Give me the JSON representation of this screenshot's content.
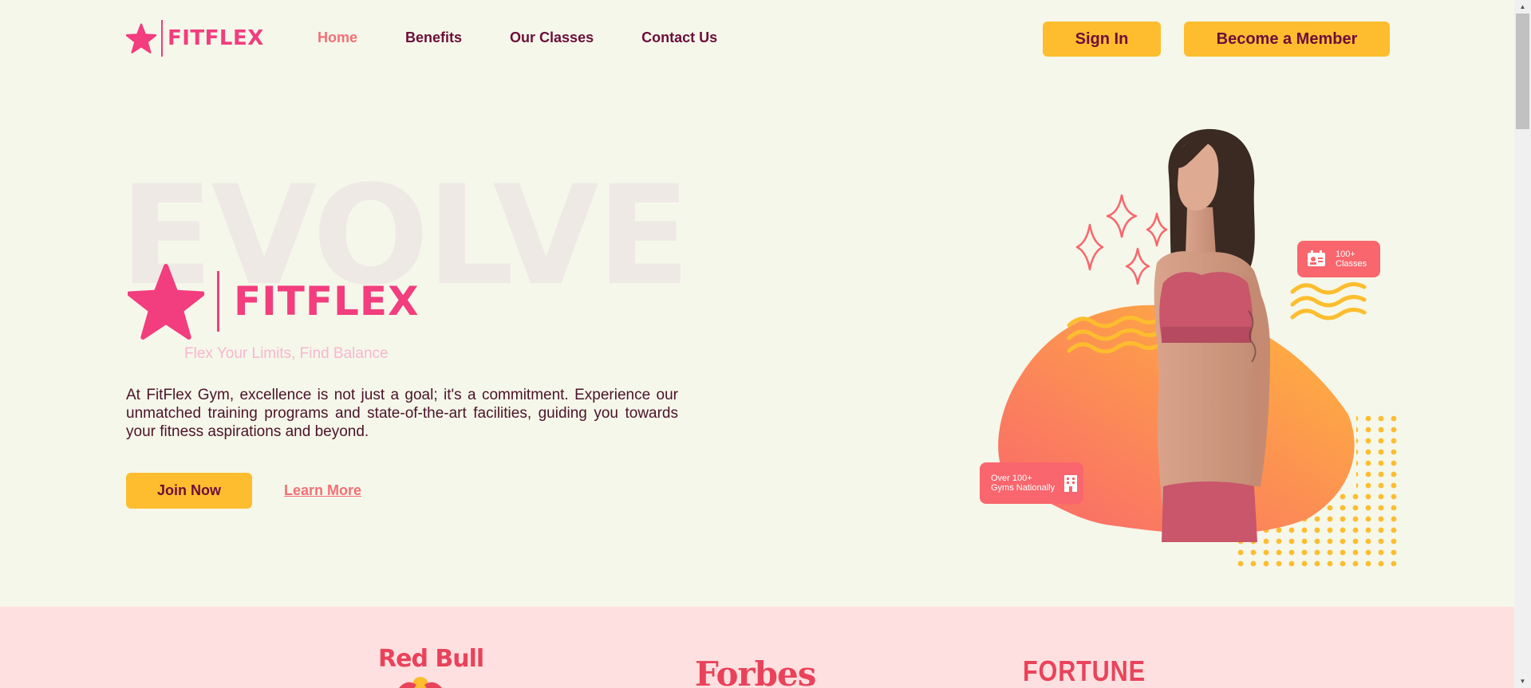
{
  "header": {
    "logo_text": "FITFLEX",
    "nav": [
      {
        "label": "Home",
        "active": true
      },
      {
        "label": "Benefits",
        "active": false
      },
      {
        "label": "Our Classes",
        "active": false
      },
      {
        "label": "Contact Us",
        "active": false
      }
    ],
    "sign_in_label": "Sign In",
    "member_label": "Become a Member"
  },
  "hero": {
    "bg_word": "EVOLVE",
    "logo_text": "FITFLEX",
    "tagline": "Flex Your Limits, Find Balance",
    "description": "At FitFlex Gym, excellence is not just a goal; it's a commitment. Experience our unmatched training programs and state-of-the-art facilities, guiding you towards your fitness aspirations and beyond.",
    "join_label": "Join Now",
    "learn_label": "Learn More",
    "card_classes": {
      "line1": "100+",
      "line2": "Classes"
    },
    "card_gyms": {
      "line1": "Over 100+",
      "line2": "Gyms Nationally"
    }
  },
  "partners": {
    "redbull": "Red Bull",
    "forbes": "Forbes",
    "fortune": "FORTUNE"
  },
  "colors": {
    "background": "#f5f7ea",
    "brand_pink": "#f23d7e",
    "accent_yellow": "#fdbd2e",
    "text_maroon": "#6b0f3a",
    "coral": "#f27076",
    "partner_band": "#ffe0e0"
  },
  "icons": [
    "star-logo-icon",
    "id-card-icon",
    "building-icon",
    "sparkle-icon",
    "scroll-up-arrow-icon",
    "scroll-down-arrow-icon"
  ]
}
